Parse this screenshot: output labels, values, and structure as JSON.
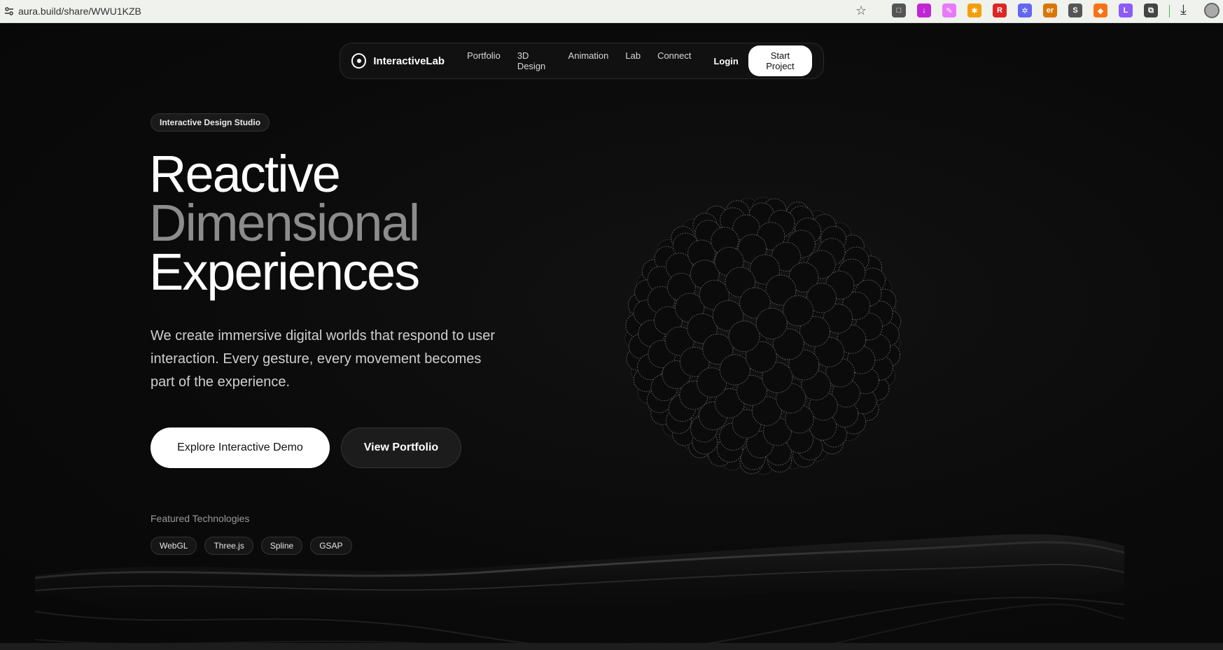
{
  "browser": {
    "url": "aura.build/share/WWU1KZB",
    "extensions": [
      {
        "icon": "extension-x-icon",
        "color": "#555555",
        "glyph": "□"
      },
      {
        "icon": "download-arrow-icon",
        "color": "#c026d3",
        "glyph": "↓"
      },
      {
        "icon": "eyedropper-icon",
        "color": "#e879f9",
        "glyph": "✎"
      },
      {
        "icon": "fox-icon",
        "color": "#f59e0b",
        "glyph": "✱"
      },
      {
        "icon": "red-r-icon",
        "color": "#dc2626",
        "glyph": "R"
      },
      {
        "icon": "gear-badge-icon",
        "color": "#6366f1",
        "glyph": "✲"
      },
      {
        "icon": "er-icon",
        "color": "#d97706",
        "glyph": "er"
      },
      {
        "icon": "s-icon",
        "color": "#555555",
        "glyph": "S"
      },
      {
        "icon": "metamask-icon",
        "color": "#f97316",
        "glyph": "◆"
      },
      {
        "icon": "l-icon",
        "color": "#8b5cf6",
        "glyph": "L"
      },
      {
        "icon": "puzzle-icon",
        "color": "#444444",
        "glyph": "⧉"
      }
    ]
  },
  "nav": {
    "brand": "InteractiveLab",
    "links": [
      "Portfolio",
      "3D Design",
      "Animation",
      "Lab",
      "Connect"
    ],
    "login": "Login",
    "cta": "Start Project"
  },
  "hero": {
    "badge": "Interactive Design Studio",
    "headline": [
      "Reactive",
      "Dimensional",
      "Experiences"
    ],
    "description": "We create immersive digital worlds that respond to user interaction. Every gesture, every movement becomes part of the experience.",
    "primary_button": "Explore Interactive Demo",
    "secondary_button": "View Portfolio"
  },
  "featured": {
    "label": "Featured Technologies",
    "technologies": [
      "WebGL",
      "Three.js",
      "Spline",
      "GSAP"
    ]
  },
  "colors": {
    "background": "#0a0a0a",
    "accent_white": "#ffffff",
    "headline_muted": "#8c8c8c"
  }
}
